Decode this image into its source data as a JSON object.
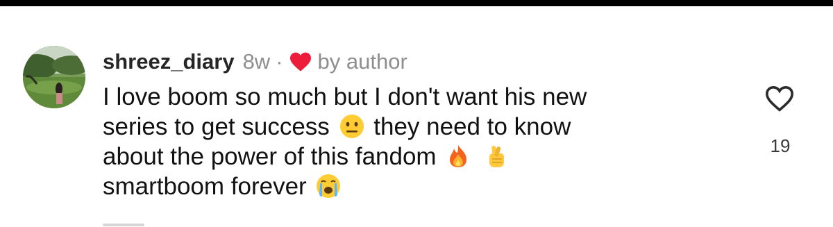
{
  "comment": {
    "username": "shreez_diary",
    "timestamp": "8w",
    "separator": "·",
    "liked_by_author_label": "by author",
    "lines": [
      {
        "before": "I love boom so much but I don't want his new"
      },
      {
        "before": "series to get success",
        "emoji1": "neutral-face-emoji",
        "after": "they need to know"
      },
      {
        "before": "about the power of this fandom",
        "emoji1": "fire-emoji",
        "emoji2": "crossed-fingers-emoji"
      },
      {
        "before": "smartboom forever",
        "emoji1": "loudly-crying-face-emoji"
      }
    ]
  },
  "like": {
    "icon": "heart-outline-icon",
    "count": "19"
  },
  "colors": {
    "author_heart": "#ed1c3a",
    "muted_text": "#8e8e8e",
    "text": "#111111",
    "top_bar": "#000000"
  }
}
